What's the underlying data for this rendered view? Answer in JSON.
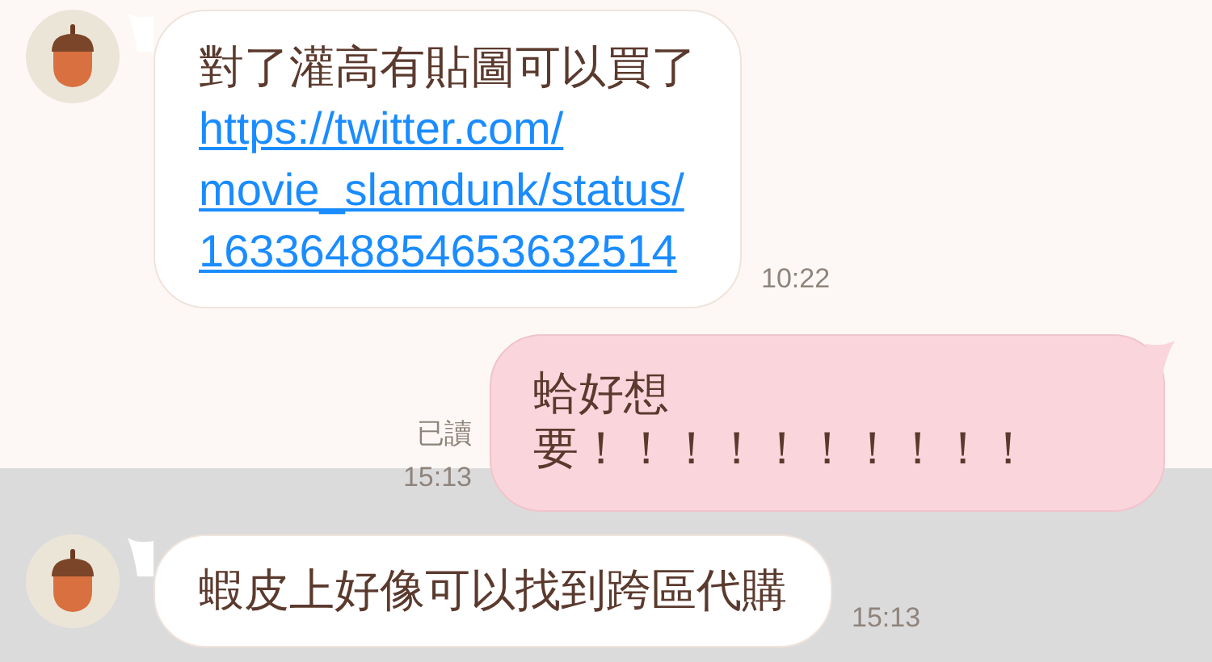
{
  "messages": [
    {
      "kind": "incoming",
      "lines": [
        {
          "kind": "text",
          "text": "對了灌高有貼圖可以買了"
        },
        {
          "kind": "link",
          "text": "https://twitter.com/"
        },
        {
          "kind": "link",
          "text": "movie_slamdunk/status/"
        },
        {
          "kind": "link",
          "text": "1633648854653632514"
        }
      ],
      "time": "10:22"
    },
    {
      "kind": "outgoing",
      "lines": [
        {
          "kind": "text",
          "text": "蛤好想"
        },
        {
          "kind": "text",
          "text": "要！！！！！！！！！！"
        }
      ],
      "read_status": "已讀",
      "time": "15:13"
    },
    {
      "kind": "incoming",
      "lines": [
        {
          "kind": "text",
          "text": "蝦皮上好像可以找到跨區代購"
        }
      ],
      "time": "15:13"
    }
  ]
}
